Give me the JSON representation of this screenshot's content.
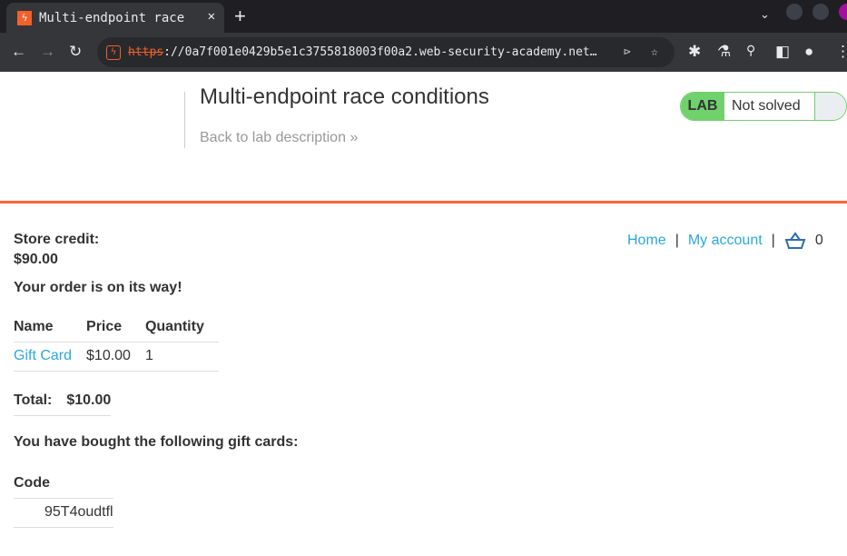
{
  "browser": {
    "tab_title": "Multi-endpoint race",
    "url_scheme": "https",
    "url_rest": "://0a7f001e0429b5e1c3755818003f00a2.web-security-academy.net…"
  },
  "header": {
    "title": "Multi-endpoint race conditions",
    "back_link": "Back to lab description",
    "lab_label": "LAB",
    "status": "Not solved"
  },
  "nav": {
    "home": "Home",
    "account": "My account",
    "sep": "|",
    "cart_count": "0"
  },
  "main": {
    "credit_label": "Store credit:",
    "credit_value": "$90.00",
    "order_msg": "Your order is on its way!",
    "columns": [
      "Name",
      "Price",
      "Quantity"
    ],
    "rows": [
      {
        "name": "Gift Card",
        "price": "$10.00",
        "qty": "1"
      }
    ],
    "total_label": "Total:",
    "total_value": "$10.00",
    "gift_msg": "You have bought the following gift cards:",
    "code_header": "Code",
    "codes": [
      "95T4oudtfl"
    ]
  },
  "colors": {
    "accent": "#ff6633",
    "link": "#29a8e0",
    "lab_green": "#70d16d"
  }
}
